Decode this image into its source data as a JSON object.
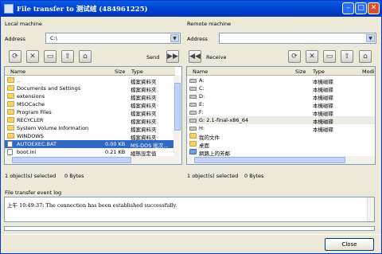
{
  "window": {
    "title": "File transfer to 测试绒 (484961225)",
    "minimize": "–",
    "maximize": "□",
    "close": "✕"
  },
  "local": {
    "heading": "Local machine",
    "address_label": "Address",
    "address_value": "C:\\",
    "direction_label": "Send",
    "columns": {
      "name": "Name",
      "size": "Size",
      "type": "Type"
    },
    "items": [
      {
        "name": "..",
        "size": "",
        "type": "檔案資料夾",
        "icon": "folder-up-icon",
        "selected": false
      },
      {
        "name": "Documents and Settings",
        "size": "",
        "type": "檔案資料夾",
        "icon": "folder-icon",
        "selected": false
      },
      {
        "name": "extensions",
        "size": "",
        "type": "檔案資料夾",
        "icon": "folder-icon",
        "selected": false
      },
      {
        "name": "MSOCache",
        "size": "",
        "type": "檔案資料夾",
        "icon": "folder-icon",
        "selected": false
      },
      {
        "name": "Program Files",
        "size": "",
        "type": "檔案資料夾",
        "icon": "folder-icon",
        "selected": false
      },
      {
        "name": "RECYCLER",
        "size": "",
        "type": "檔案資料夾",
        "icon": "folder-icon",
        "selected": false
      },
      {
        "name": "System Volume Information",
        "size": "",
        "type": "檔案資料夾",
        "icon": "folder-icon",
        "selected": false
      },
      {
        "name": "WINDOWS",
        "size": "",
        "type": "檔案資料夾",
        "icon": "folder-icon",
        "selected": false
      },
      {
        "name": "AUTOEXEC.BAT",
        "size": "0.00 KB",
        "type": "MS-DOS 批次...",
        "icon": "file-icon",
        "selected": true
      },
      {
        "name": "boot.ini",
        "size": "0.21 KB",
        "type": "組態設定值",
        "icon": "file-icon",
        "selected": false
      }
    ],
    "status": "1 object(s) selected",
    "bytes": "0 Bytes"
  },
  "remote": {
    "heading": "Remote machine",
    "address_label": "Address",
    "address_value": "",
    "direction_label": "Receive",
    "columns": {
      "name": "Name",
      "size": "Size",
      "type": "Type",
      "modified": "Modi"
    },
    "items": [
      {
        "name": "A:",
        "type": "本機磁碟",
        "icon": "drive-icon"
      },
      {
        "name": "C:",
        "type": "本機磁碟",
        "icon": "drive-icon"
      },
      {
        "name": "D:",
        "type": "本機磁碟",
        "icon": "drive-icon"
      },
      {
        "name": "E:",
        "type": "本機磁碟",
        "icon": "drive-icon"
      },
      {
        "name": "F:",
        "type": "本機磁碟",
        "icon": "drive-icon"
      },
      {
        "name": "G:  2.1-final-x86_64",
        "type": "本機磁碟",
        "icon": "drive-icon"
      },
      {
        "name": "H:",
        "type": "本機磁碟",
        "icon": "drive-icon"
      },
      {
        "name": "我的文件",
        "type": "",
        "icon": "documents-folder-icon"
      },
      {
        "name": "桌面",
        "type": "",
        "icon": "desktop-folder-icon"
      },
      {
        "name": "網路上的芳鄰",
        "type": "",
        "icon": "network-icon"
      }
    ],
    "status": "1 object(s) selected",
    "bytes": "0 Bytes"
  },
  "log": {
    "heading": "File transfer event log",
    "entries": [
      "上午 10:49:37: The connection has been established successfully."
    ]
  },
  "close_button": "Close"
}
